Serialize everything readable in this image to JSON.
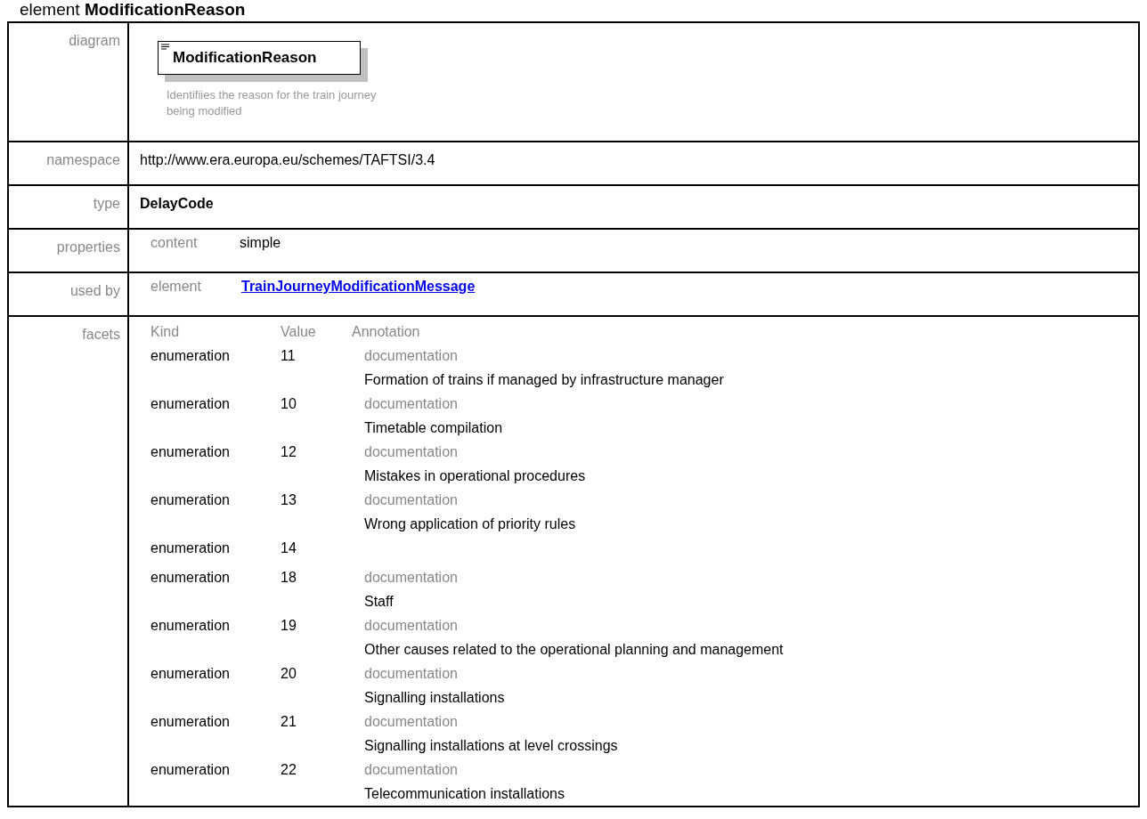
{
  "heading": {
    "prefix": "element",
    "name": "ModificationReason"
  },
  "diagram": {
    "label": "diagram",
    "element_name": "ModificationReason",
    "description": "Identifiies the reason for the train journey being modified"
  },
  "namespace": {
    "label": "namespace",
    "value": "http://www.era.europa.eu/schemes/TAFTSI/3.4"
  },
  "type": {
    "label": "type",
    "value": "DelayCode"
  },
  "properties": {
    "label": "properties",
    "key": "content",
    "value": "simple"
  },
  "used_by": {
    "label": "used by",
    "key": "element",
    "link": "TrainJourneyModificationMessage"
  },
  "facets": {
    "label": "facets",
    "columns": [
      "Kind",
      "Value",
      "Annotation"
    ],
    "rows": [
      {
        "kind": "enumeration",
        "value": "11",
        "annotation_label": "documentation",
        "annotation": "Formation of trains if managed by infrastructure manager"
      },
      {
        "kind": "enumeration",
        "value": "10",
        "annotation_label": "documentation",
        "annotation": "Timetable compilation"
      },
      {
        "kind": "enumeration",
        "value": "12",
        "annotation_label": "documentation",
        "annotation": "Mistakes in operational procedures"
      },
      {
        "kind": "enumeration",
        "value": "13",
        "annotation_label": "documentation",
        "annotation": "Wrong application of priority rules"
      },
      {
        "kind": "enumeration",
        "value": "14"
      },
      {
        "kind": "enumeration",
        "value": "18",
        "annotation_label": "documentation",
        "annotation": "Staff"
      },
      {
        "kind": "enumeration",
        "value": "19",
        "annotation_label": "documentation",
        "annotation": "Other causes related to the operational planning and management"
      },
      {
        "kind": "enumeration",
        "value": "20",
        "annotation_label": "documentation",
        "annotation": "Signalling installations"
      },
      {
        "kind": "enumeration",
        "value": "21",
        "annotation_label": "documentation",
        "annotation": "Signalling installations at level crossings"
      },
      {
        "kind": "enumeration",
        "value": "22",
        "annotation_label": "documentation",
        "annotation": "Telecommunication installations"
      }
    ]
  }
}
